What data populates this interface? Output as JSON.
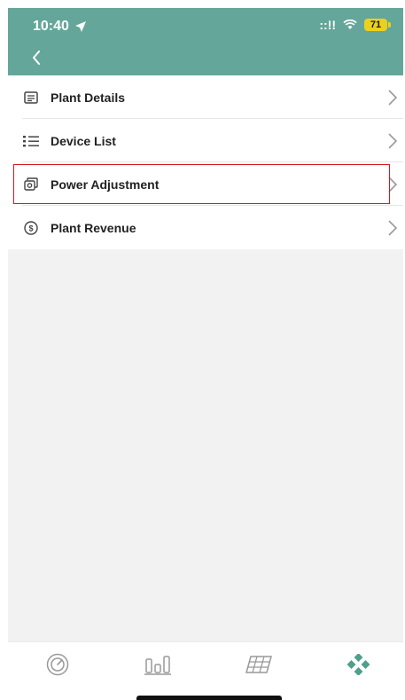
{
  "status_bar": {
    "time": "10:40",
    "signal": "::!!",
    "battery": "71"
  },
  "menu": {
    "items": [
      {
        "label": "Plant Details",
        "icon": "plant-details-icon"
      },
      {
        "label": "Device List",
        "icon": "list-icon"
      },
      {
        "label": "Power Adjustment",
        "icon": "power-adjustment-icon",
        "highlighted": true
      },
      {
        "label": "Plant Revenue",
        "icon": "dollar-icon"
      }
    ]
  },
  "tabbar": {
    "tabs": [
      {
        "icon": "gauge-icon"
      },
      {
        "icon": "bar-chart-icon"
      },
      {
        "icon": "solar-panel-icon"
      },
      {
        "icon": "more-grid-icon",
        "active": true
      }
    ]
  },
  "colors": {
    "header": "#64a79a",
    "highlight": "#d9141c",
    "accent": "#4f9f8c",
    "battery": "#ecd11b"
  }
}
